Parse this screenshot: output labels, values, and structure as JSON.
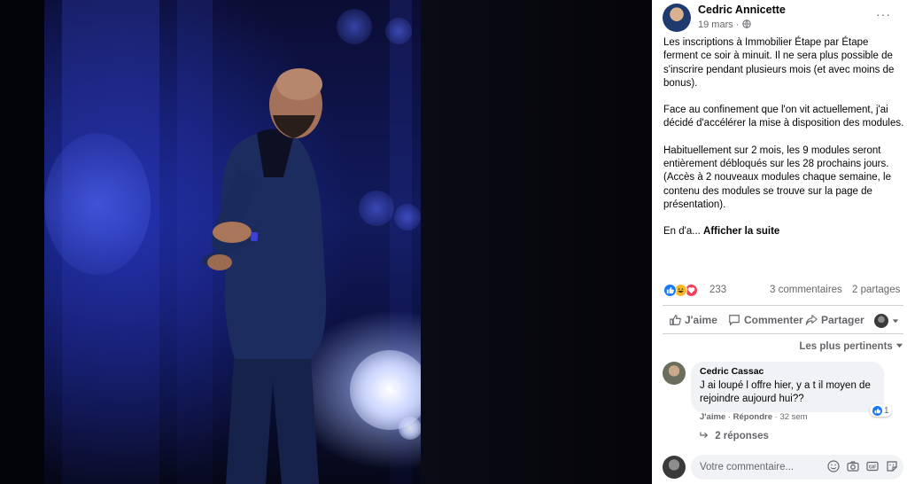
{
  "post": {
    "author": "Cedric Annicette",
    "date": "19 mars · ",
    "more": "···",
    "paragraphs": [
      "Les inscriptions à Immobilier Étape par Étape ferment ce soir à minuit. Il ne sera plus possible de s'inscrire pendant plusieurs mois (et avec moins de bonus).",
      "Face au confinement que l'on vit actuellement, j'ai décidé d'accélérer la mise à disposition des modules.",
      "Habituellement sur 2 mois, les 9 modules seront entièrement débloqués sur les 28 prochains jours. (Accès à 2 nouveaux modules chaque semaine, le contenu des modules se trouve sur la page de présentation)."
    ],
    "truncated": "En d'a... ",
    "see_more": "Afficher la suite"
  },
  "stats": {
    "reactions": "233",
    "comments": "3 commentaires",
    "shares": "2 partages",
    "reaction_icons": [
      "like-icon",
      "haha-icon",
      "love-icon"
    ],
    "colors": {
      "like": "#1877f2",
      "haha": "#f7b928",
      "love": "#f33e58"
    }
  },
  "actions": {
    "like": "J'aime",
    "comment": "Commenter",
    "share": "Partager"
  },
  "sort_label": "Les plus pertinents",
  "comment": {
    "name": "Cedric Cassac",
    "text": "J ai loupé l offre hier, y a t il moyen de rejoindre aujourd hui??",
    "like_count": "1",
    "meta_like": "J'aime",
    "meta_reply": "Répondre",
    "meta_time": " · 32 sem",
    "replies": "2 réponses"
  },
  "composer": {
    "placeholder": "Votre commentaire..."
  }
}
